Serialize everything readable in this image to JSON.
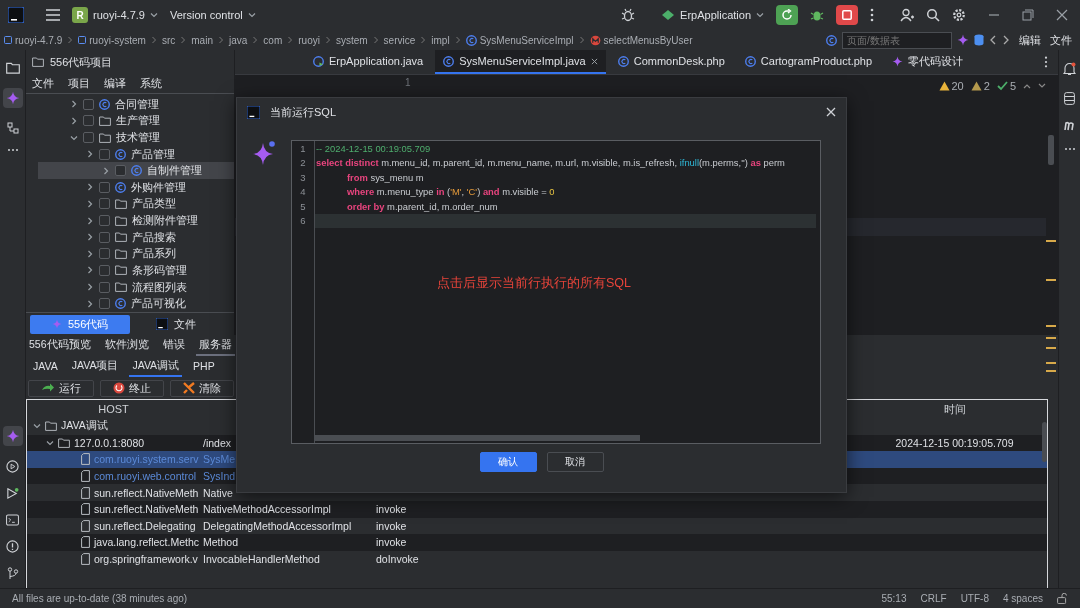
{
  "window": {
    "project_badge": "R",
    "project": "ruoyi-4.7.9",
    "vcs": "Version control",
    "run_config": "ErpApplication"
  },
  "breadcrumb": [
    {
      "label": "ruoyi-4.7.9",
      "kind": "module"
    },
    {
      "label": "ruoyi-system",
      "kind": "module"
    },
    {
      "label": "src",
      "kind": "folder"
    },
    {
      "label": "main",
      "kind": "folder"
    },
    {
      "label": "java",
      "kind": "folder"
    },
    {
      "label": "com",
      "kind": "folder"
    },
    {
      "label": "ruoyi",
      "kind": "folder"
    },
    {
      "label": "system",
      "kind": "folder"
    },
    {
      "label": "service",
      "kind": "folder"
    },
    {
      "label": "impl",
      "kind": "folder"
    },
    {
      "label": "SysMenuServiceImpl",
      "kind": "class"
    },
    {
      "label": "selectMenusByUser",
      "kind": "method"
    }
  ],
  "nav_search": {
    "placeholder": "页面/数据表"
  },
  "nav_actions": [
    "编辑",
    "文件"
  ],
  "project_panel": {
    "title": "556代码项目",
    "menu": [
      "文件",
      "项目",
      "编译",
      "系统"
    ],
    "tree": [
      {
        "label": "合同管理",
        "kind": "class",
        "checked": false,
        "expanded": false,
        "selected": false
      },
      {
        "label": "生产管理",
        "kind": "folder",
        "checked": false,
        "expanded": false,
        "selected": false
      },
      {
        "label": "技术管理",
        "kind": "folder",
        "checked": false,
        "expanded": true,
        "selected": false,
        "children": [
          {
            "label": "产品管理",
            "kind": "class",
            "checked": false,
            "expanded": false,
            "selected": false
          },
          {
            "label": "自制件管理",
            "kind": "class",
            "checked": false,
            "expanded": false,
            "selected": true
          },
          {
            "label": "外购件管理",
            "kind": "class",
            "checked": false,
            "expanded": false,
            "selected": false
          },
          {
            "label": "产品类型",
            "kind": "folder",
            "checked": false,
            "expanded": false,
            "selected": false
          },
          {
            "label": "检测附件管理",
            "kind": "folder",
            "checked": false,
            "expanded": false,
            "selected": false
          },
          {
            "label": "产品搜索",
            "kind": "folder",
            "checked": false,
            "expanded": false,
            "selected": false
          },
          {
            "label": "产品系列",
            "kind": "folder",
            "checked": false,
            "expanded": false,
            "selected": false
          },
          {
            "label": "条形码管理",
            "kind": "folder",
            "checked": false,
            "expanded": false,
            "selected": false
          },
          {
            "label": "流程图列表",
            "kind": "folder",
            "checked": false,
            "expanded": false,
            "selected": false
          },
          {
            "label": "产品可视化",
            "kind": "class",
            "checked": false,
            "expanded": false,
            "selected": false
          }
        ]
      }
    ],
    "tabs": [
      {
        "label": "556代码",
        "kind": "sparkle",
        "selected": true
      },
      {
        "label": "文件",
        "kind": "ide",
        "selected": false
      }
    ]
  },
  "editor": {
    "tabs": [
      {
        "label": "ErpApplication.java",
        "kind": "run_class",
        "selected": false,
        "closable": false
      },
      {
        "label": "SysMenuServiceImpl.java",
        "kind": "class",
        "selected": true,
        "closable": true
      },
      {
        "label": "CommonDesk.php",
        "kind": "class",
        "selected": false,
        "closable": false
      },
      {
        "label": "CartogramProduct.php",
        "kind": "class",
        "selected": false,
        "closable": false
      },
      {
        "label": "零代码设计",
        "kind": "sparkle",
        "selected": false,
        "closable": false
      }
    ],
    "line_numbers": [
      "1"
    ],
    "inspections": [
      {
        "kind": "warning",
        "count": "20"
      },
      {
        "kind": "weak_warning",
        "count": "2"
      },
      {
        "kind": "ok",
        "count": "5"
      }
    ]
  },
  "bottom_panel": {
    "tabs": [
      {
        "label": "556代码预览",
        "selected": false
      },
      {
        "label": "软件浏览",
        "selected": false
      },
      {
        "label": "错误",
        "selected": false
      },
      {
        "label": "服务器",
        "selected": true
      }
    ],
    "subtabs": [
      {
        "label": "JAVA",
        "selected": false
      },
      {
        "label": "JAVA项目",
        "selected": false
      },
      {
        "label": "JAVA调试",
        "selected": true
      },
      {
        "label": "PHP",
        "selected": false
      }
    ],
    "buttons": [
      {
        "label": "运行",
        "kind": "run"
      },
      {
        "label": "终止",
        "kind": "stop"
      },
      {
        "label": "清除",
        "kind": "clear"
      }
    ],
    "table": {
      "columns": {
        "host": "HOST",
        "time": "时间"
      },
      "rows": [
        {
          "host": "JAVA调试",
          "kind": "group",
          "expanded": true,
          "selected": false,
          "children": [
            {
              "host": "127.0.0.1:8080",
              "column_2": "/index",
              "time": "2024-12-15 00:19:05.709",
              "kind": "server",
              "expanded": true,
              "selected": false,
              "children": [
                {
                  "host": "com.ruoyi.system.serv",
                  "column_2": "SysMe",
                  "kind": "app_frame",
                  "selected": true
                },
                {
                  "host": "com.ruoyi.web.control",
                  "column_2": "SysInd",
                  "kind": "app_frame",
                  "selected": false
                },
                {
                  "host": "sun.reflect.NativeMeth",
                  "column_2": "Native",
                  "kind": "frame",
                  "selected": false
                },
                {
                  "host": "sun.reflect.NativeMeth",
                  "column_2": "NativeMethodAccessorImpl",
                  "column_3": "invoke",
                  "kind": "frame",
                  "selected": false
                },
                {
                  "host": "sun.reflect.Delegating",
                  "column_2": "DelegatingMethodAccessorImpl",
                  "column_3": "invoke",
                  "kind": "frame",
                  "selected": false
                },
                {
                  "host": "java.lang.reflect.Methc",
                  "column_2": "Method",
                  "column_3": "invoke",
                  "kind": "frame",
                  "selected": false
                },
                {
                  "host": "org.springframework.v",
                  "column_2": "InvocableHandlerMethod",
                  "column_3": "doInvoke",
                  "kind": "frame",
                  "selected": false
                }
              ]
            }
          ]
        }
      ]
    }
  },
  "dialog": {
    "title": "当前运行SQL",
    "lines": [
      {
        "number": "1",
        "active": false,
        "indented": false,
        "tokens": [
          {
            "kind": "comment",
            "text": "-- 2024-12-15 00:19:05.709"
          }
        ]
      },
      {
        "number": "2",
        "active": false,
        "indented": false,
        "tokens": [
          {
            "kind": "keyword",
            "text": "select distinct"
          },
          {
            "kind": "plain",
            "text": " m.menu_id, m.parent_id, m.menu_name, m.url, m.visible, m.is_refresh, "
          },
          {
            "kind": "function",
            "text": "ifnull"
          },
          {
            "kind": "plain",
            "text": "(m.perms,'') "
          },
          {
            "kind": "keyword",
            "text": "as"
          },
          {
            "kind": "plain",
            "text": " perm"
          }
        ]
      },
      {
        "number": "3",
        "active": false,
        "indented": true,
        "tokens": [
          {
            "kind": "keyword",
            "text": "from"
          },
          {
            "kind": "plain",
            "text": " sys_menu m"
          }
        ]
      },
      {
        "number": "4",
        "active": false,
        "indented": true,
        "tokens": [
          {
            "kind": "keyword",
            "text": "where"
          },
          {
            "kind": "plain",
            "text": " m.menu_type "
          },
          {
            "kind": "keyword",
            "text": "in"
          },
          {
            "kind": "plain",
            "text": " ("
          },
          {
            "kind": "string",
            "text": "'M'"
          },
          {
            "kind": "plain",
            "text": ", "
          },
          {
            "kind": "string",
            "text": "'C'"
          },
          {
            "kind": "plain",
            "text": ") "
          },
          {
            "kind": "keyword",
            "text": "and"
          },
          {
            "kind": "plain",
            "text": " m.visible = "
          },
          {
            "kind": "number",
            "text": "0"
          }
        ]
      },
      {
        "number": "5",
        "active": false,
        "indented": true,
        "tokens": [
          {
            "kind": "keyword",
            "text": "order by"
          },
          {
            "kind": "plain",
            "text": " m.parent_id, m.order_num"
          }
        ]
      },
      {
        "number": "6",
        "active": true,
        "indented": false
      }
    ],
    "note": "点击后显示当前行执行的所有SQL",
    "buttons": [
      {
        "label": "确认",
        "primary": true
      },
      {
        "label": "取消",
        "primary": false
      }
    ]
  },
  "status_bar": {
    "message": "All files are up-to-date (38 minutes ago)",
    "items": [
      "55:13",
      "CRLF",
      "UTF-8",
      "4 spaces"
    ]
  }
}
